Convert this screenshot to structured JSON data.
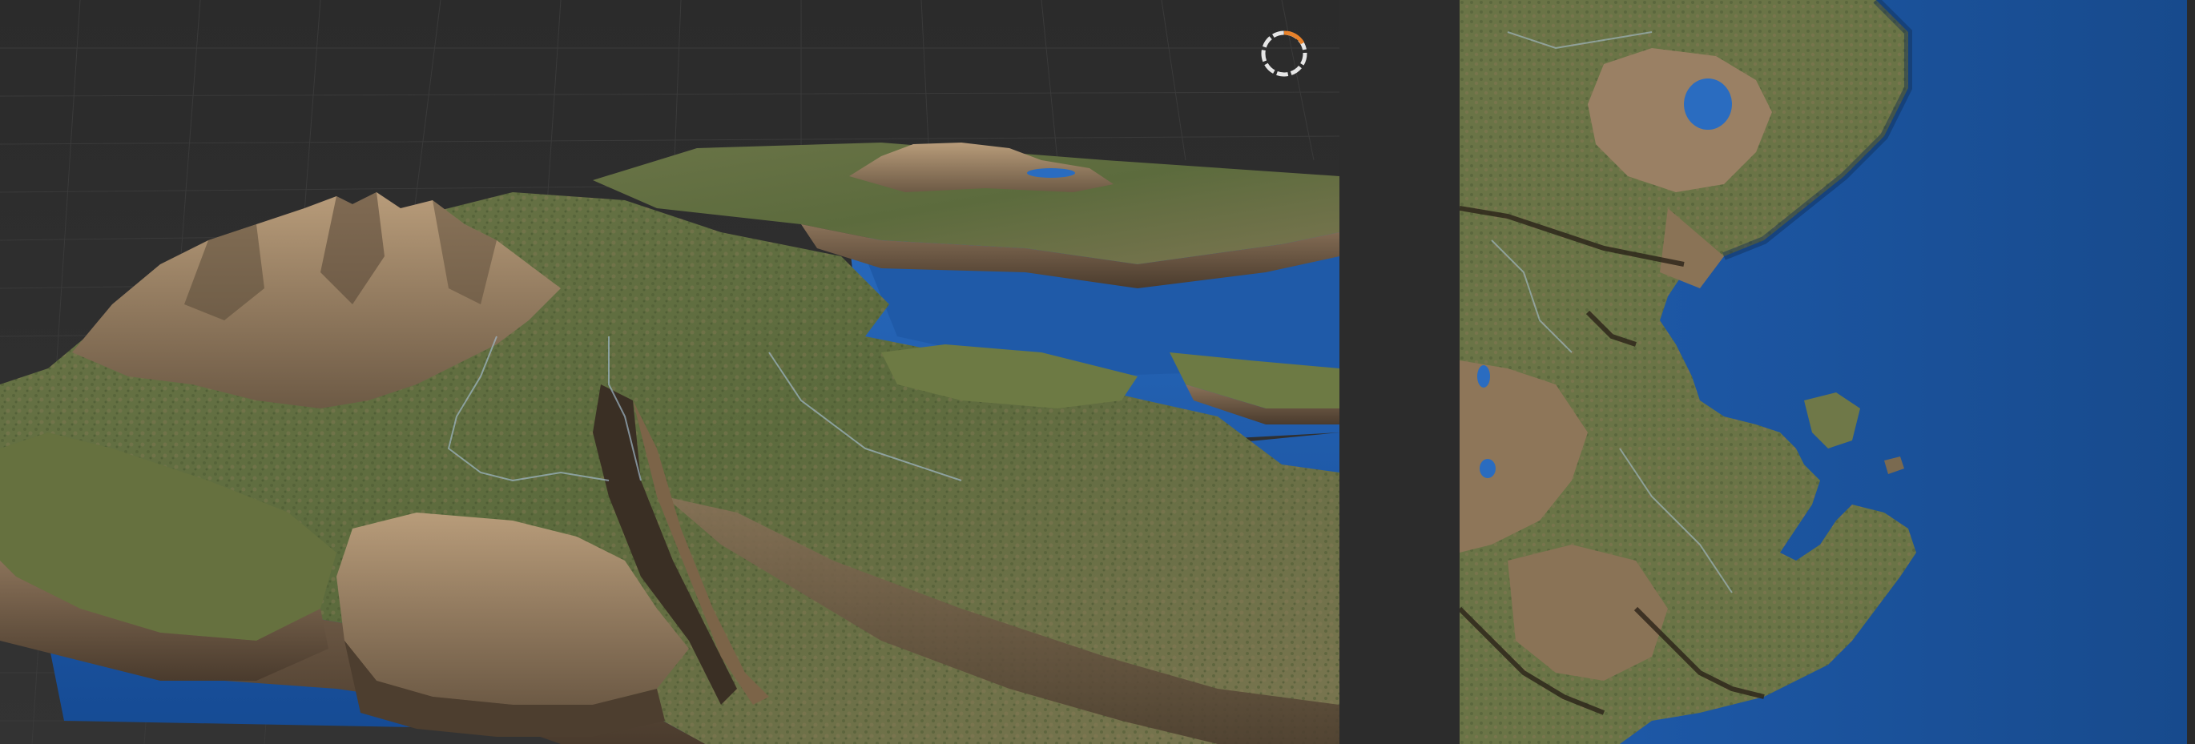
{
  "viewports": {
    "perspective": {
      "view": "3d-terrain",
      "grid": true
    },
    "top": {
      "view": "2d-terrain"
    }
  },
  "loading_indicator": {
    "progress": 0.22
  },
  "colors": {
    "background": "#2b2b2b",
    "water": "#1a4a86",
    "water_light": "#2a6bbf",
    "grass": "#5a6b3e",
    "rock": "#8d7559",
    "accent": "#e8822a"
  }
}
